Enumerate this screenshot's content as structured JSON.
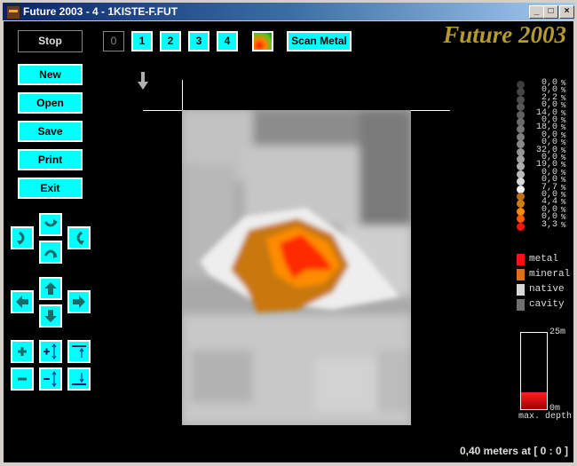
{
  "window": {
    "title": "Future 2003 - 4 - 1KISTE-F.FUT",
    "controls": {
      "minimize": "_",
      "maximize": "□",
      "close": "×"
    }
  },
  "toolbar": {
    "stop_label": "Stop",
    "layers": [
      "0",
      "1",
      "2",
      "3",
      "4"
    ],
    "active_layer": "0",
    "scan_label": "Scan Metal",
    "brand": "Future 2003"
  },
  "sidebar": {
    "file_buttons": [
      "New",
      "Open",
      "Save",
      "Print",
      "Exit"
    ],
    "rotate_icons": [
      "rotate-up-icon",
      "rotate-left-icon",
      "rotate-right-icon",
      "rotate-down-icon"
    ],
    "move_icons": [
      "arrow-up-icon",
      "arrow-left-icon",
      "arrow-right-icon",
      "arrow-down-icon"
    ],
    "zoom_icons": [
      "zoom-in-icon",
      "stretch-in-icon",
      "depth-top-icon",
      "zoom-out-icon",
      "stretch-out-icon",
      "depth-bottom-icon"
    ]
  },
  "scale": {
    "percent_sign": "%",
    "rows": [
      {
        "value": "0,0",
        "color": "#3c3c3c"
      },
      {
        "value": "0,0",
        "color": "#454545"
      },
      {
        "value": "2,2",
        "color": "#4e4e4e"
      },
      {
        "value": "0,0",
        "color": "#575757"
      },
      {
        "value": "14,0",
        "color": "#606060"
      },
      {
        "value": "0,0",
        "color": "#6a6a6a"
      },
      {
        "value": "18,0",
        "color": "#747474"
      },
      {
        "value": "0,0",
        "color": "#7e7e7e"
      },
      {
        "value": "0,0",
        "color": "#898989"
      },
      {
        "value": "32,0",
        "color": "#949494"
      },
      {
        "value": "0,0",
        "color": "#a0a0a0"
      },
      {
        "value": "19,0",
        "color": "#adadad"
      },
      {
        "value": "0,0",
        "color": "#bababa"
      },
      {
        "value": "0,0",
        "color": "#d8d8d8"
      },
      {
        "value": "7,7",
        "color": "#f0f0f0"
      },
      {
        "value": "0,0",
        "color": "#c07010"
      },
      {
        "value": "4,4",
        "color": "#d07c10"
      },
      {
        "value": "0,0",
        "color": "#ff8c00"
      },
      {
        "value": "0,0",
        "color": "#ff5a00"
      },
      {
        "value": "3,3",
        "color": "#ff1010"
      }
    ]
  },
  "legend": [
    {
      "label": "metal",
      "color": "#ff1010"
    },
    {
      "label": "mineral",
      "color": "#e07010"
    },
    {
      "label": "native",
      "color": "#d8d8d8"
    },
    {
      "label": "cavity",
      "color": "#707070"
    }
  ],
  "depth": {
    "max_label": "25m",
    "min_label": "0m",
    "caption": "max. depth",
    "fill_fraction": 0.22
  },
  "status": {
    "text": "0,40 meters at [ 0 : 0 ]"
  },
  "colors": {
    "button_bg": "#00ffff",
    "brand": "#b59a2c",
    "metal": "#ff1010",
    "mineral": "#e07010"
  }
}
